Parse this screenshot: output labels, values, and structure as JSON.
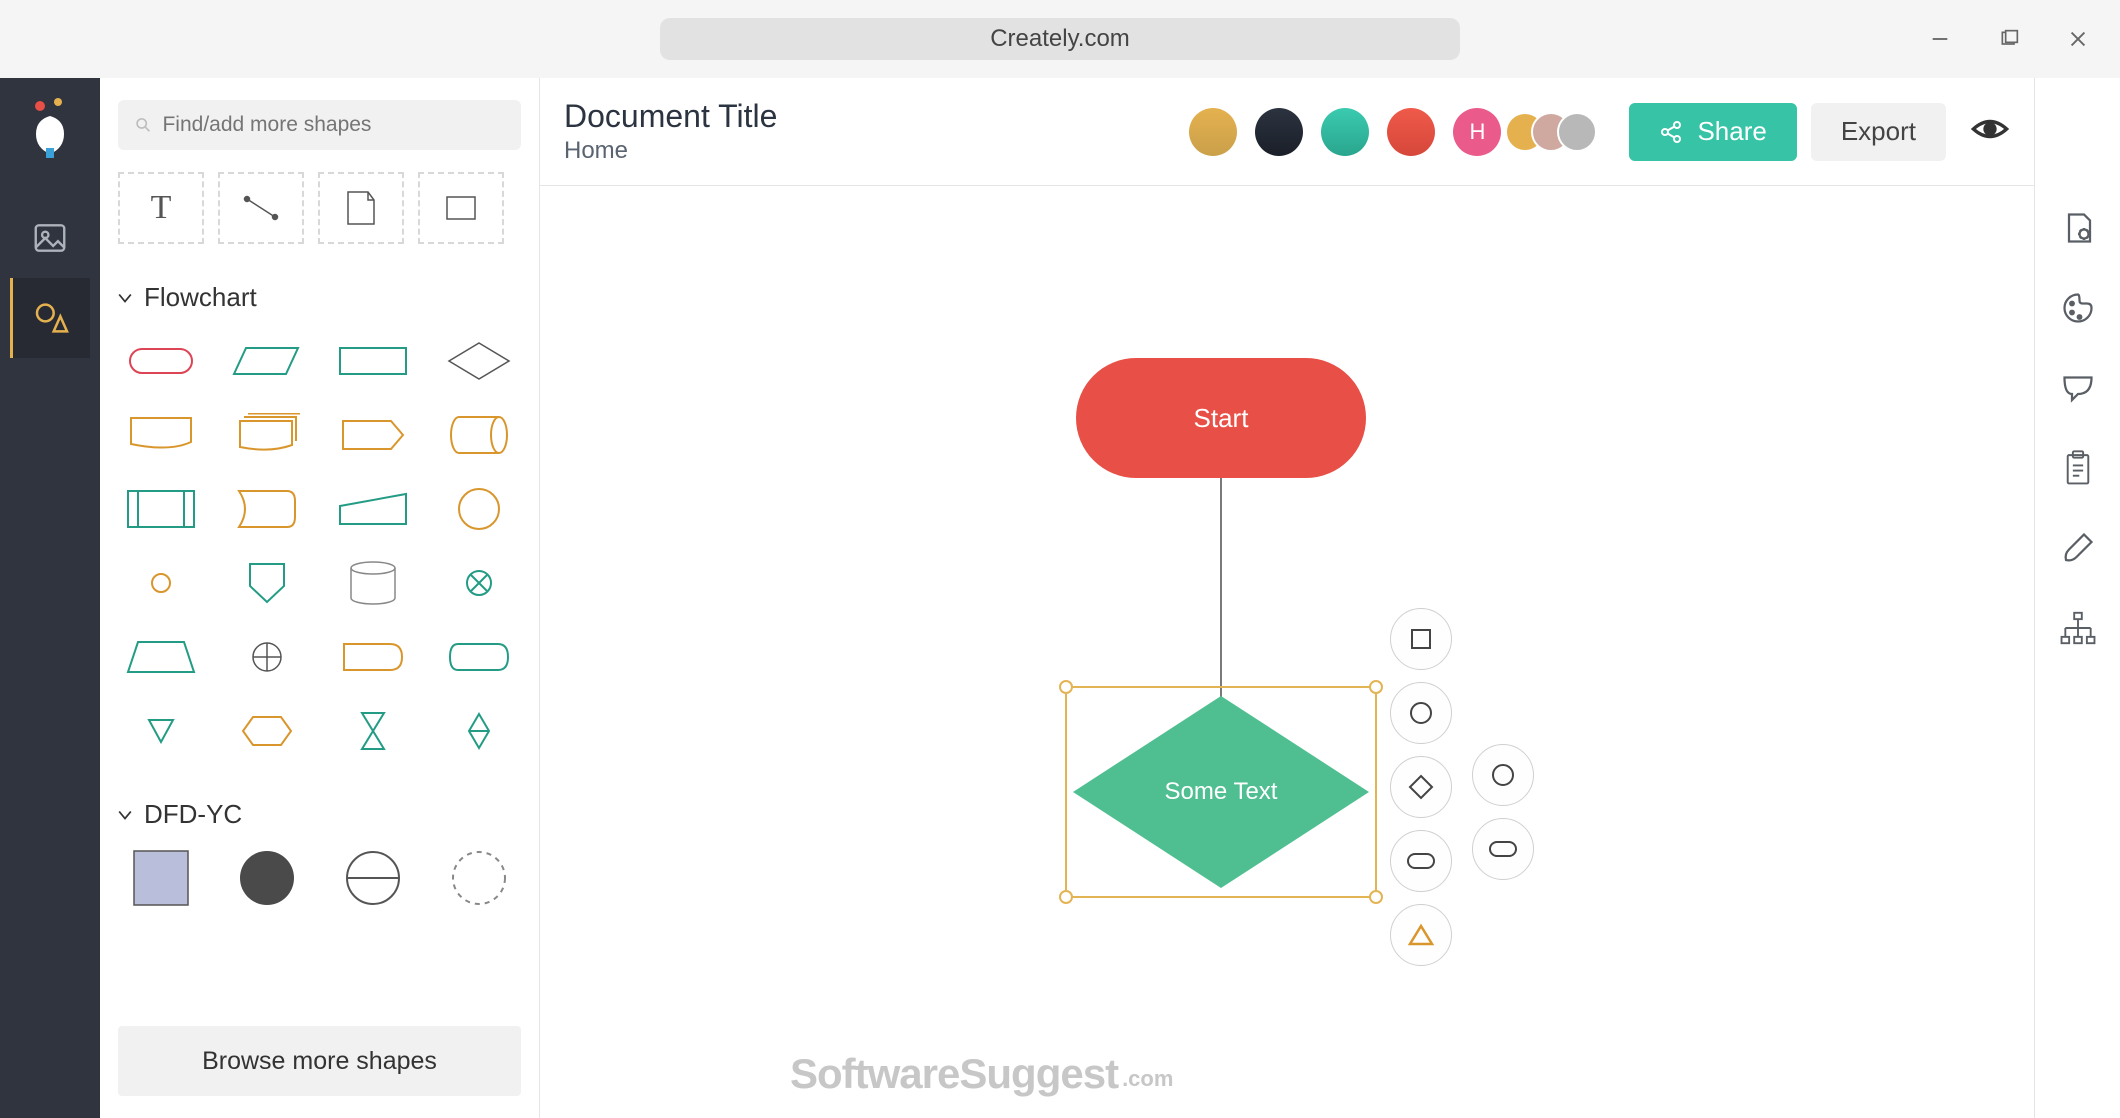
{
  "browser": {
    "url": "Creately.com"
  },
  "leftRail": {
    "imageTabName": "image-library",
    "shapesTabName": "shapes-library"
  },
  "shapePanel": {
    "searchPlaceholder": "Find/add more shapes",
    "quickTools": [
      "text",
      "line",
      "page",
      "rectangle"
    ],
    "sections": {
      "flowchart": {
        "title": "Flowchart",
        "shapes": [
          "terminator",
          "parallelogram",
          "rectangle",
          "diamond",
          "card",
          "stacked-card",
          "tag",
          "cylinder-h",
          "subprocess",
          "rounded-card",
          "trapezoid-side",
          "circle",
          "small-circle",
          "shield",
          "cylinder-v",
          "crossed-circle",
          "trapezoid",
          "crosshair",
          "rounded-rect",
          "display",
          "triangle-down",
          "hexagon",
          "hourglass",
          "diamond-small"
        ]
      },
      "dfd": {
        "title": "DFD-YC",
        "shapes": [
          "square-filled",
          "circle-filled",
          "half-circle",
          "dashed-circle"
        ]
      }
    },
    "browseMore": "Browse more shapes"
  },
  "header": {
    "title": "Document Title",
    "breadcrumb": "Home",
    "collaborators": [
      {
        "id": "u1",
        "bg": "#e5b14f"
      },
      {
        "id": "u2",
        "bg": "#1d2733"
      },
      {
        "id": "u3",
        "bg": "#36c3a6"
      },
      {
        "id": "u4",
        "bg": "#e74f47"
      },
      {
        "id": "u5",
        "bg": "#ea5b8c",
        "initial": "H"
      }
    ],
    "clusterCount": 3,
    "shareLabel": "Share",
    "exportLabel": "Export"
  },
  "canvas": {
    "startLabel": "Start",
    "decisionLabel": "Some Text",
    "quickShapesPrimary": [
      "square",
      "circle",
      "diamond",
      "pill",
      "triangle"
    ],
    "quickShapesSecondary": [
      "circle",
      "pill"
    ]
  },
  "rightRail": {
    "tools": [
      "doc-settings",
      "palette",
      "comment",
      "clipboard",
      "brush",
      "sitemap"
    ]
  },
  "watermark": {
    "brand": "SoftwareSuggest",
    "ext": ".com"
  }
}
